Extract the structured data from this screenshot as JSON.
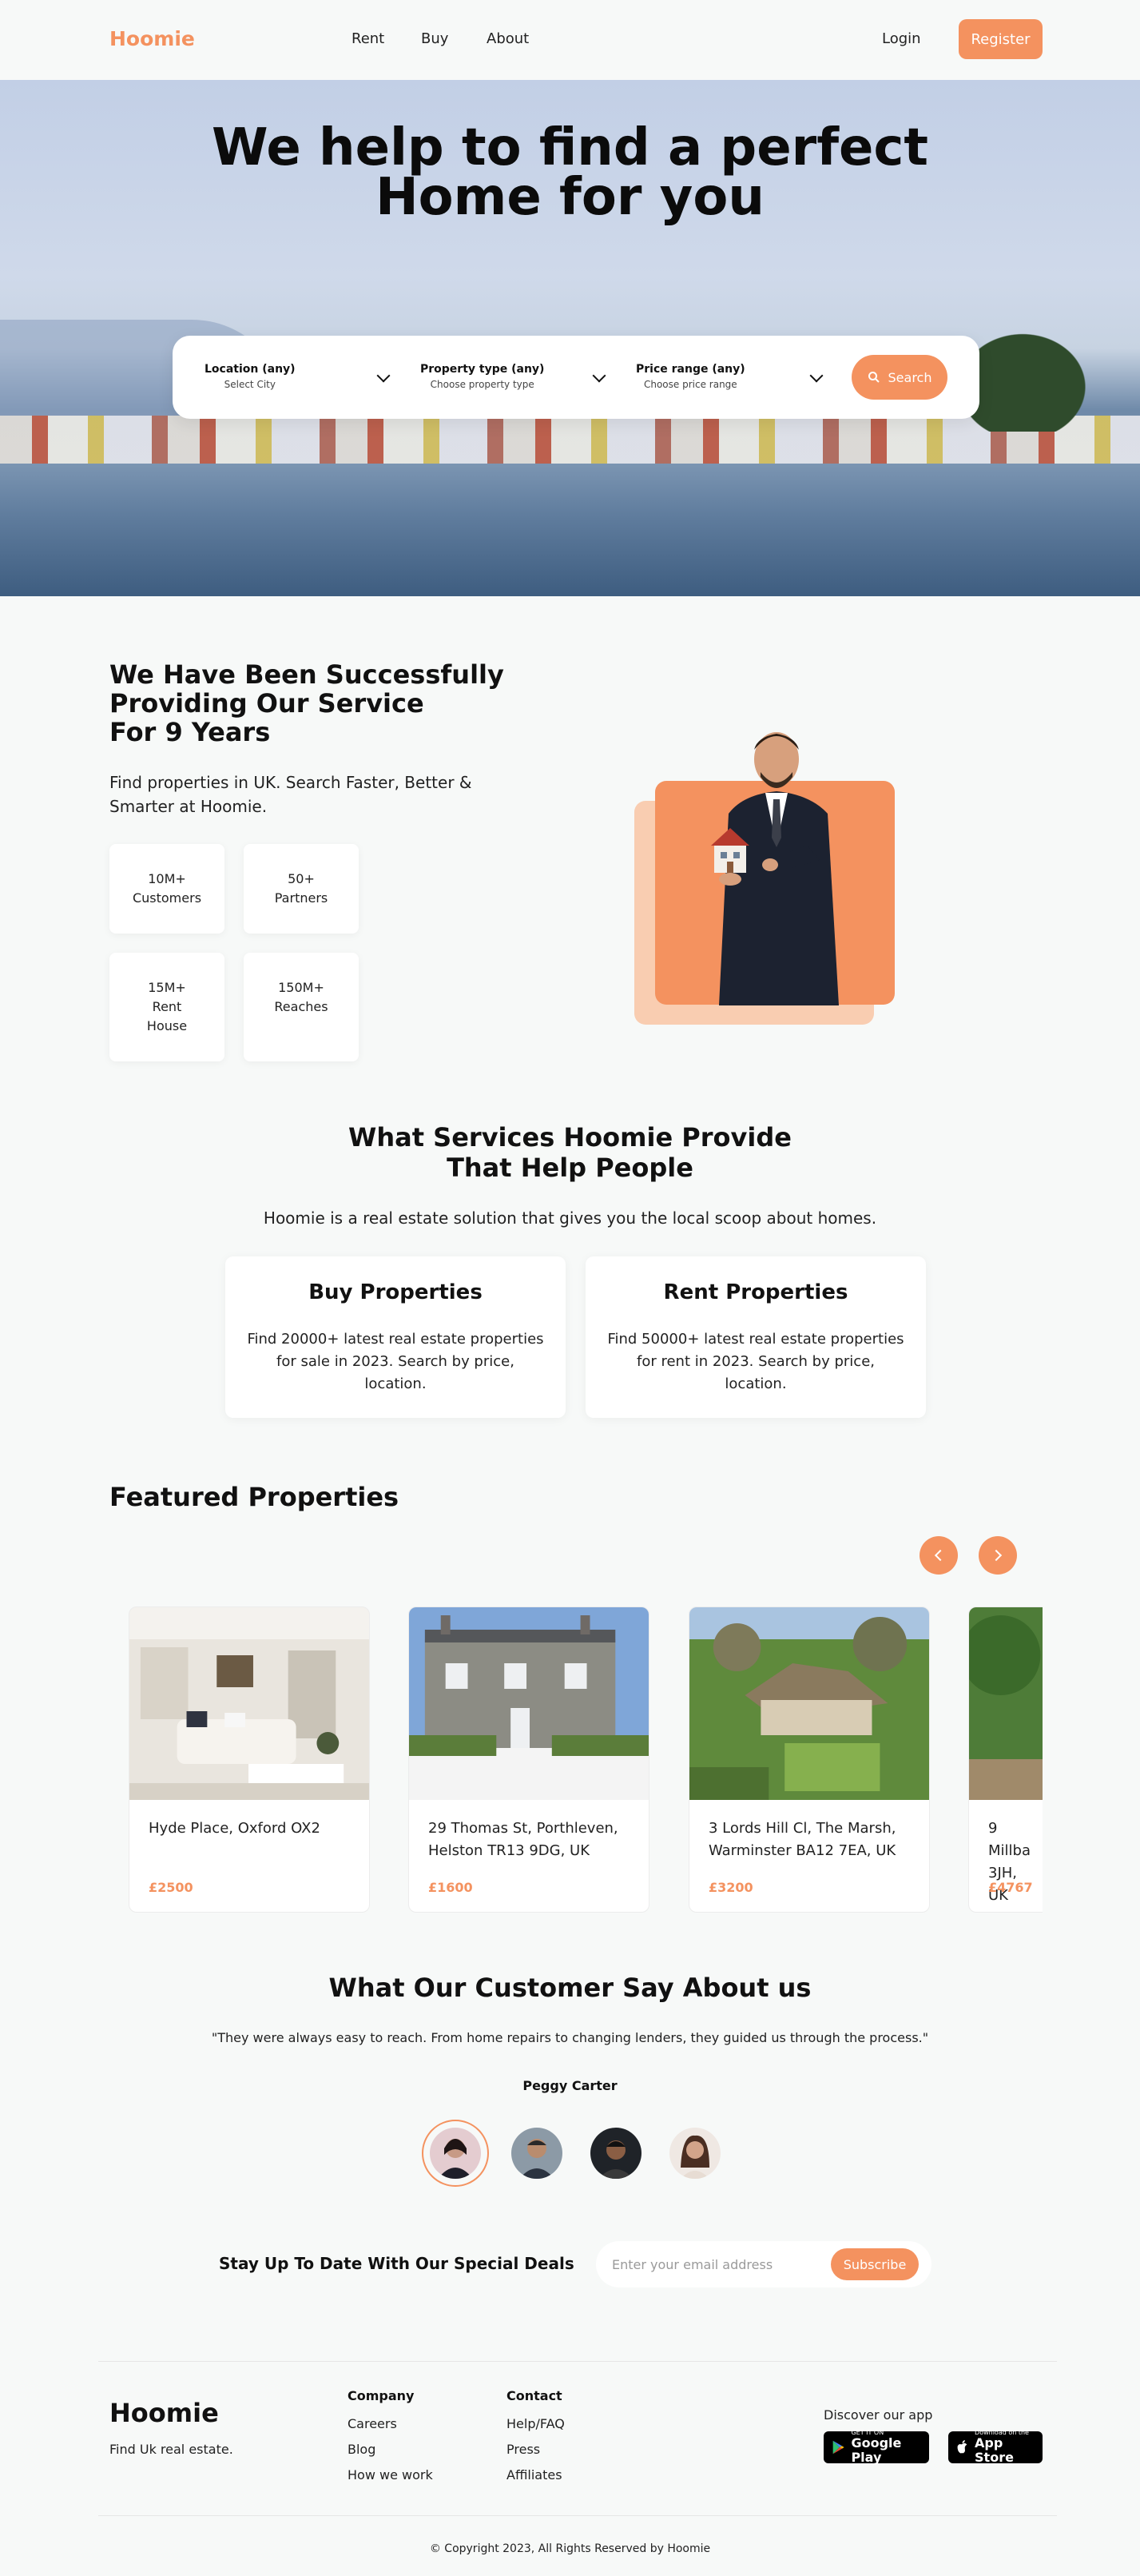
{
  "header": {
    "logo": "Hoomie",
    "nav": [
      "Rent",
      "Buy",
      "About"
    ],
    "login": "Login",
    "register": "Register"
  },
  "hero": {
    "title_line1": "We help to find a perfect",
    "title_line2": "Home for you",
    "filters": [
      {
        "label": "Location (any)",
        "sub": "Select City"
      },
      {
        "label": "Property type (any)",
        "sub": "Choose property type"
      },
      {
        "label": "Price range (any)",
        "sub": "Choose price range"
      }
    ],
    "search_label": "Search"
  },
  "about": {
    "title_line1": "We Have Been Successfully",
    "title_line2": "Providing Our Service",
    "title_line3": "For 9 Years",
    "description": "Find properties in UK. Search Faster, Better & Smarter at Hoomie.",
    "stats": [
      {
        "value": "10M+",
        "label": "Customers"
      },
      {
        "value": "50+",
        "label": "Partners"
      },
      {
        "value": "15M+",
        "label": "Rent House"
      },
      {
        "value": "150M+",
        "label": "Reaches"
      }
    ]
  },
  "services": {
    "title_line1": "What Services Hoomie Provide",
    "title_line2": "That Help People",
    "description": "Hoomie is a real estate solution that gives you the local scoop about homes.",
    "cards": [
      {
        "title": "Buy Properties",
        "text": "Find 20000+ latest real estate properties for sale in 2023. Search by price, location."
      },
      {
        "title": "Rent Properties",
        "text": "Find 50000+ latest real estate properties for rent in 2023. Search by price, location."
      }
    ]
  },
  "featured": {
    "title": "Featured Properties",
    "properties": [
      {
        "address": "Hyde Place, Oxford OX2",
        "price": "£2500"
      },
      {
        "address": "29 Thomas St, Porthleven, Helston TR13 9DG, UK",
        "price": "£1600"
      },
      {
        "address": "3 Lords Hill Cl, The Marsh, Warminster BA12 7EA, UK",
        "price": "£3200"
      },
      {
        "address": "9 Millba 3JH, UK",
        "price": "£4767"
      }
    ]
  },
  "testimonials": {
    "title": "What Our Customer Say About us",
    "quote": "\"They were always easy to reach. From home repairs to changing lenders, they guided us through the process.\"",
    "name": "Peggy Carter"
  },
  "newsletter": {
    "title": "Stay Up To Date With Our Special Deals",
    "placeholder": "Enter your email address",
    "button": "Subscribe"
  },
  "footer": {
    "logo": "Hoomie",
    "tagline": "Find Uk real estate.",
    "company_heading": "Company",
    "company_links": [
      "Careers",
      "Blog",
      "How we work"
    ],
    "contact_heading": "Contact",
    "contact_links": [
      "Help/FAQ",
      "Press",
      "Affiliates"
    ],
    "app_heading": "Discover our app",
    "google_small": "GET IT ON",
    "google_big": "Google Play",
    "apple_small": "Download on the",
    "apple_big": "App Store",
    "copyright": "© Copyright 2023, All Rights Reserved by Hoomie"
  },
  "colors": {
    "accent": "#f4925f",
    "accent_light": "#f9cdb1",
    "background": "#f7f9f8"
  }
}
